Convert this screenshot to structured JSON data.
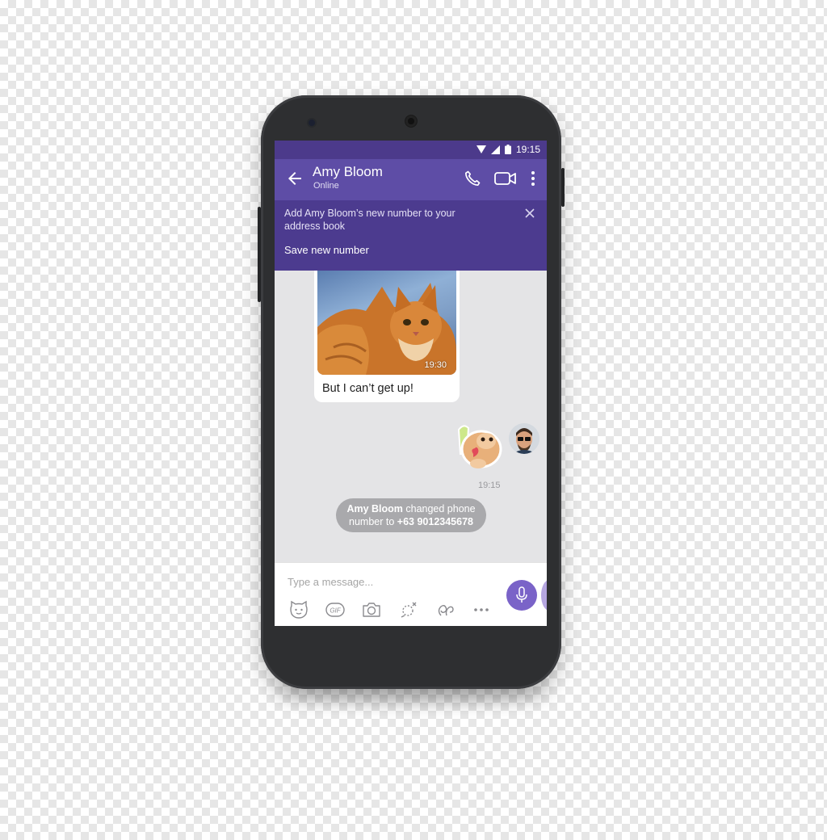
{
  "status_bar": {
    "time": "19:15"
  },
  "header": {
    "contact_name": "Amy Bloom",
    "contact_status": "Online"
  },
  "banner": {
    "text": "Add Amy Bloom’s new number to your address book",
    "action": "Save new number"
  },
  "messages": {
    "incoming_photo_time": "19:30",
    "incoming_text": "But I can’t get up!",
    "outgoing_time": "19:15"
  },
  "system_message": {
    "name": "Amy Bloom",
    "line1_rest": " changed phone",
    "line2_prefix": "number to ",
    "number": "+63 9012345678"
  },
  "composer": {
    "placeholder": "Type a message...",
    "tools": [
      "sticker-icon",
      "gif-icon",
      "camera-icon",
      "doodle-icon",
      "location-icon",
      "more-options-icon"
    ],
    "gif_label": "GIF"
  },
  "colors": {
    "status_bar": "#4c3a8b",
    "app_bar": "#5e4da6",
    "banner": "#4c3b8f",
    "mic_button": "#7a63c8",
    "chat_background": "#e4e4e6"
  }
}
